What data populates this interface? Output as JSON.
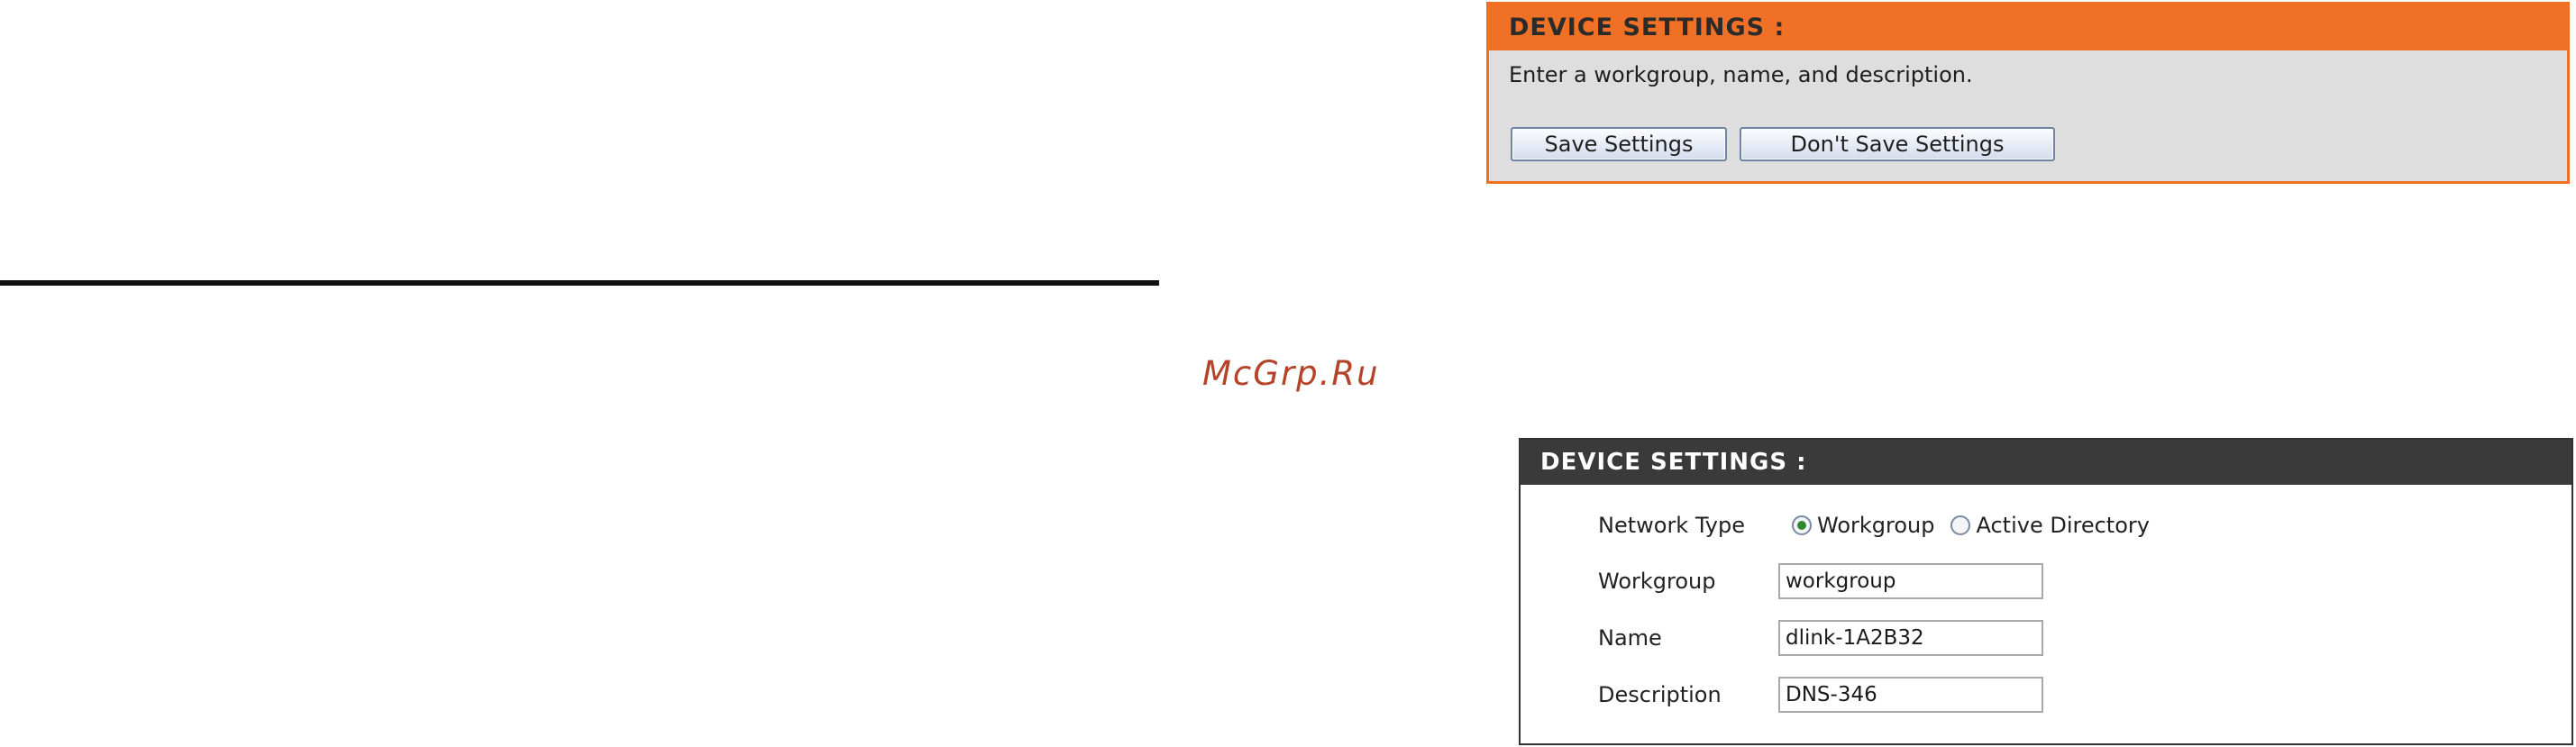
{
  "save_panel": {
    "title": "DEVICE SETTINGS :",
    "description": "Enter a workgroup, name, and description.",
    "save_label": "Save Settings",
    "dont_save_label": "Don't Save Settings"
  },
  "watermark": "McGrp.Ru",
  "settings_panel": {
    "title": "DEVICE SETTINGS :",
    "network_type": {
      "label": "Network Type",
      "options": [
        "Workgroup",
        "Active Directory"
      ],
      "selected": "Workgroup"
    },
    "workgroup": {
      "label": "Workgroup",
      "value": "workgroup"
    },
    "name": {
      "label": "Name",
      "value": "dlink-1A2B32"
    },
    "description": {
      "label": "Description",
      "value": "DNS-346"
    }
  },
  "colors": {
    "accent_orange": "#f07126",
    "dark_header": "#3a3a3a",
    "panel_bg": "#dedede"
  }
}
